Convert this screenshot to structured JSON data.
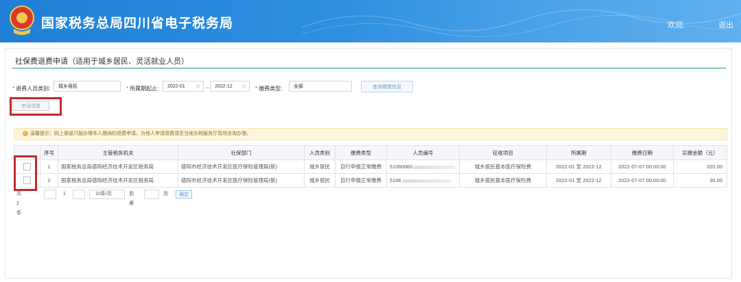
{
  "header": {
    "title": "国家税务总局四川省电子税务局",
    "welcome": "欢迎,",
    "logout": "退出"
  },
  "panel": {
    "title": "社保费退费申请（适用于城乡居民、灵活就业人员）"
  },
  "filters": {
    "person_type_label": "退费人员类别:",
    "person_type_value": "城乡居民",
    "period_label": "所属期起止:",
    "period_start": "2022-01",
    "period_end": "2022-12",
    "period_sep": "~",
    "fee_type_label": "缴费类型:",
    "fee_type_value": "全部",
    "query_button": "查询缴费信息"
  },
  "apply_button": "申请退费",
  "notice": "温馨提示：网上渠道只能办理本人缴纳的退费申请，为他人申请退费请至当地办税服务厅现场咨询办理。",
  "table": {
    "columns": [
      "",
      "序号",
      "主管税务机关",
      "社保部门",
      "人员类别",
      "缴费类型",
      "人员编号",
      "征收项目",
      "所属期",
      "缴费日期",
      "实缴金额（元）"
    ],
    "rows": [
      {
        "no": "1",
        "tax_office": "国家税务总局德阳经济技术开发区税务局",
        "ss_dept": "德阳市经济技术开发区医疗保险管理局(新)",
        "person_type": "城乡居民",
        "fee_type": "自行申报正常缴费",
        "person_id": "51060060",
        "item": "城乡居民基本医疗保险费",
        "period": "2022-01 至 2022-12",
        "pay_date": "2022-07-07 00:00:00",
        "amount": "320.00"
      },
      {
        "no": "2",
        "tax_office": "国家税务总局德阳经济技术开发区税务局",
        "ss_dept": "德阳市经济技术开发区医疗保险管理局(新)",
        "person_type": "城乡居民",
        "fee_type": "自行申报正常缴费",
        "person_id": "5106",
        "item": "城乡居民基本医疗保险费",
        "period": "2022-01 至 2022-12",
        "pay_date": "2022-07-07 00:00:00",
        "amount": "30.00"
      }
    ]
  },
  "pager": {
    "total_prefix": "共",
    "total": "2",
    "total_suffix": "条",
    "page": "1",
    "page_size": "10条/页",
    "goto_label": "到第",
    "page_unit": "页",
    "confirm": "确定"
  },
  "colors": {
    "header_blue": "#2e8fe0",
    "panel_rule": "#1a9a8a",
    "highlight_red": "#c0282d"
  }
}
